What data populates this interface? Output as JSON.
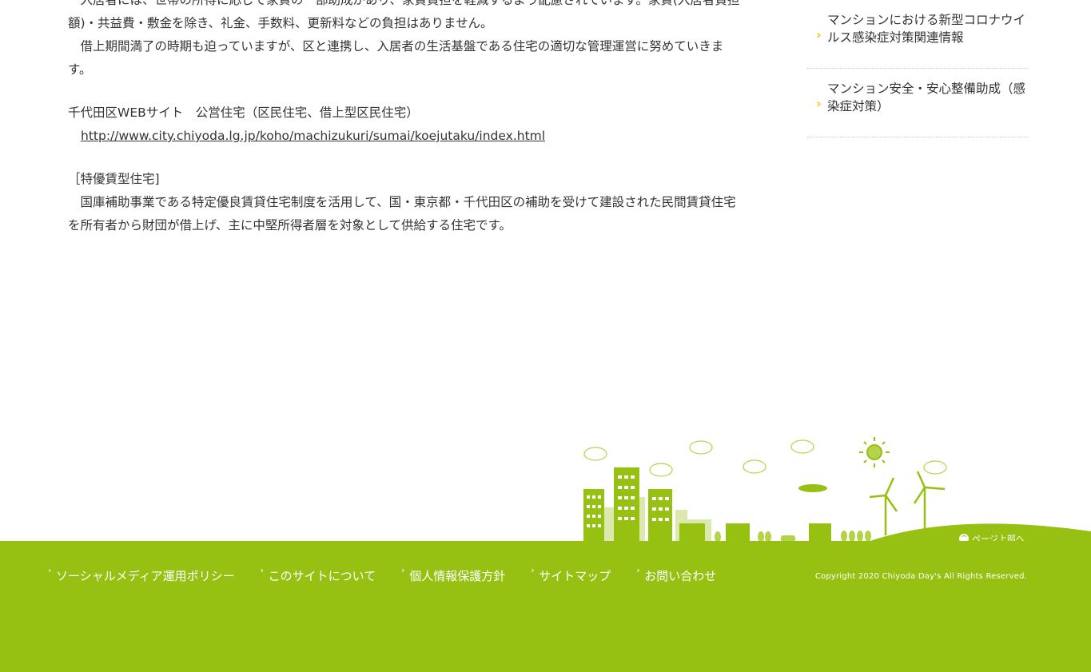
{
  "main": {
    "para1_line1": "　入居者には、世帯の所得に応じて家賃の一部助成があり、家賃負担を軽減するよう配慮されています。家賃(入居者負担",
    "para1_line2": "額)・共益費・敷金を除き、礼金、手数料、更新料などの負担はありません。",
    "para2": "　借上期間満了の時期も迫っていますが、区と連携し、入居者の生活基盤である住宅の適切な管理運営に努めていきま",
    "para2_end": "す。",
    "site_label": "千代田区WEBサイト　公営住宅（区民住宅、借上型区民住宅）",
    "site_link": "http://www.city.chiyoda.lg.jp/koho/machizukuri/sumai/koejutaku/index.html",
    "section_heading": "［特優賃型住宅]",
    "para3_line1": "　国庫補助事業である特定優良賃貸住宅制度を活用して、国・東京都・千代田区の補助を受けて建設された民間賃貸住宅",
    "para3_line2": "を所有者から財団が借上げ、主に中堅所得者層を対象として供給する住宅です。"
  },
  "sidebar": {
    "items": [
      {
        "label": "マンションにおける新型コロナウイルス感染症対策関連情報"
      },
      {
        "label": "マンション安全・安心整備助成（感染症対策）"
      }
    ]
  },
  "footer": {
    "links": [
      {
        "label": "ソーシャルメディア運用ポリシー"
      },
      {
        "label": "このサイトについて"
      },
      {
        "label": "個人情報保護方針"
      },
      {
        "label": "サイトマップ"
      },
      {
        "label": "お問い合わせ"
      }
    ],
    "copyright": "Copyright 2020 Chiyoda Day's All Rights Reserved.",
    "page_top": "ページ上部へ"
  },
  "colors": {
    "footer_green": "#97c112",
    "chevron_yellow": "#f0c419"
  }
}
